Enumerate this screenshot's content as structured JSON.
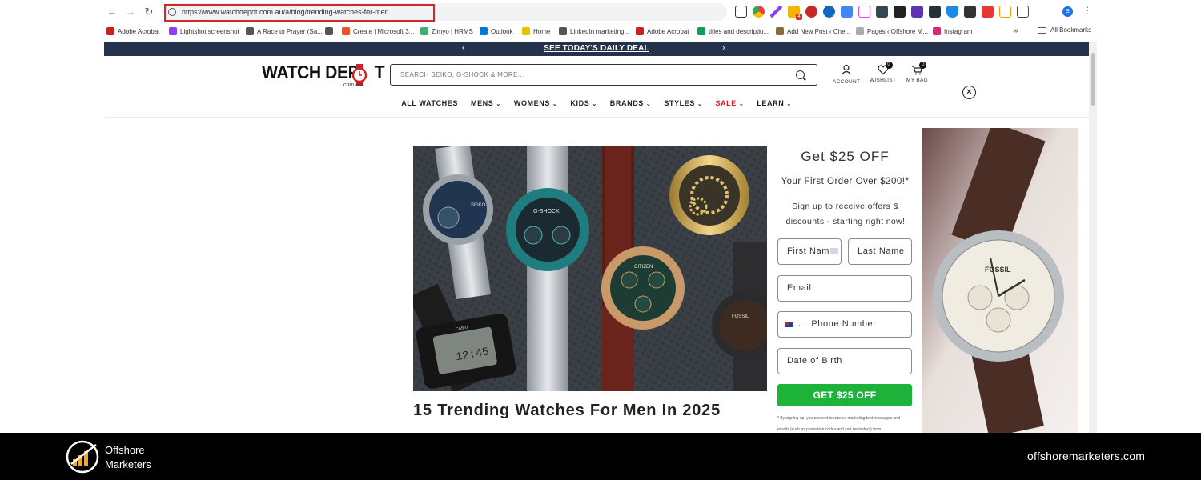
{
  "browser": {
    "url": "https://www.watchdepot.com.au/a/blog/trending-watches-for-men",
    "profile_initial": "S",
    "extension_badge": "4",
    "bookmarks": [
      {
        "label": "Adobe Acrobat",
        "color": "#c8221f"
      },
      {
        "label": "Lightshot screenshot",
        "color": "#8a3ffc"
      },
      {
        "label": "A Race to Prayer (Sa...",
        "color": "#555555"
      },
      {
        "label": "",
        "color": "#555555"
      },
      {
        "label": "Create | Microsoft 3...",
        "color": "#f25022"
      },
      {
        "label": "Zimyo | HRMS",
        "color": "#3bb273"
      },
      {
        "label": "Outlook",
        "color": "#0078d4"
      },
      {
        "label": "Home",
        "color": "#e6c200"
      },
      {
        "label": "LinkedIn marketing...",
        "color": "#555555"
      },
      {
        "label": "Adobe Acrobat",
        "color": "#c8221f"
      },
      {
        "label": "titles and descriptio...",
        "color": "#0f9d58"
      },
      {
        "label": "Add New Post ‹ Che...",
        "color": "#8a6d3b"
      },
      {
        "label": "Pages ‹ Offshore M...",
        "color": "#aaaaaa"
      },
      {
        "label": "Instagram",
        "color": "#d62976"
      }
    ],
    "bookmarks_more": "»",
    "all_bookmarks": "All Bookmarks"
  },
  "site": {
    "announcement": "SEE TODAY'S DAILY DEAL",
    "logo_text": "WATCH DEP",
    "logo_text_end": "T",
    "logo_sub": ".com.au",
    "search_placeholder": "SEARCH SEIKO, G-SHOCK & MORE...",
    "account_label": "ACCOUNT",
    "wishlist_label": "WISHLIST",
    "wishlist_count": "0",
    "bag_label": "MY BAG",
    "bag_count": "0",
    "menu": [
      {
        "label": "ALL WATCHES",
        "chevron": false,
        "sale": false
      },
      {
        "label": "MENS",
        "chevron": true,
        "sale": false
      },
      {
        "label": "WOMENS",
        "chevron": true,
        "sale": false
      },
      {
        "label": "KIDS",
        "chevron": true,
        "sale": false
      },
      {
        "label": "BRANDS",
        "chevron": true,
        "sale": false
      },
      {
        "label": "STYLES",
        "chevron": true,
        "sale": false
      },
      {
        "label": "SALE",
        "chevron": true,
        "sale": true
      },
      {
        "label": "LEARN",
        "chevron": true,
        "sale": false
      }
    ],
    "post_title": "15 Trending Watches For Men In 2025",
    "sale_color": "#d41f26",
    "announce_bg": "#25324b"
  },
  "popup": {
    "title": "Get $25 OFF",
    "subtitle": "Your First Order Over $200!*",
    "description": "Sign up to receive offers & discounts - starting right now!",
    "first_name_value": "First Nam",
    "last_name_placeholder": "Last Name",
    "email_placeholder": "Email",
    "phone_placeholder": "Phone Number",
    "dob_placeholder": "Date of Birth",
    "cta_label": "GET $25 OFF",
    "cta_color": "#1db33a",
    "disclaimer": "* By signing up, you consent to receive marketing text messages and emails (such as promotion codes and cart reminders) from",
    "close_symbol": "×",
    "photo_watch_brand": "FOSSIL"
  },
  "hero_image": {
    "watch_labels": [
      "SEIKO",
      "G-SHOCK",
      "CASIO",
      "12:45",
      "CITIZEN",
      "FOSSIL"
    ]
  },
  "footer": {
    "brand_line1": "Offshore",
    "brand_line2": "Marketers",
    "url": "offshoremarketers.com"
  }
}
